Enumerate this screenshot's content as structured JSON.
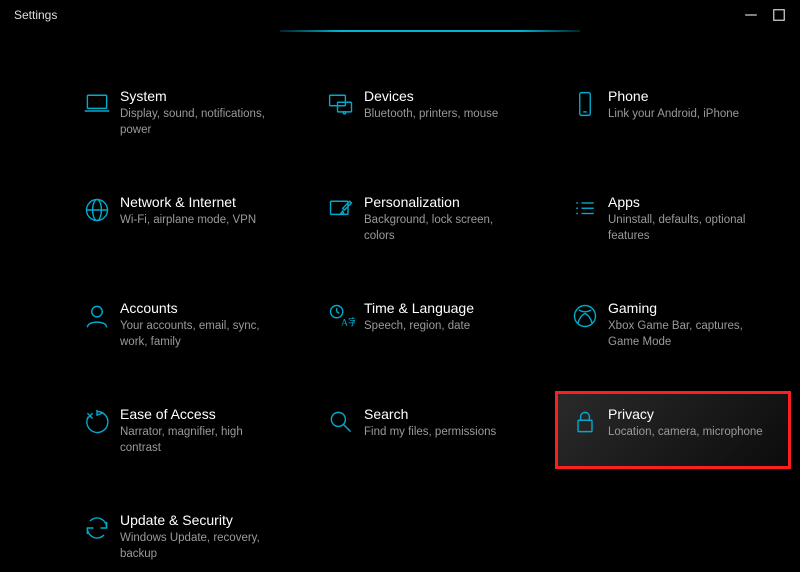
{
  "window": {
    "title": "Settings"
  },
  "accent_color": "#00aacc",
  "highlight_color": "#ff1e1e",
  "tiles": {
    "system": {
      "name": "System",
      "desc": "Display, sound, notifications, power"
    },
    "devices": {
      "name": "Devices",
      "desc": "Bluetooth, printers, mouse"
    },
    "phone": {
      "name": "Phone",
      "desc": "Link your Android, iPhone"
    },
    "network": {
      "name": "Network & Internet",
      "desc": "Wi-Fi, airplane mode, VPN"
    },
    "personalization": {
      "name": "Personalization",
      "desc": "Background, lock screen, colors"
    },
    "apps": {
      "name": "Apps",
      "desc": "Uninstall, defaults, optional features"
    },
    "accounts": {
      "name": "Accounts",
      "desc": "Your accounts, email, sync, work, family"
    },
    "time": {
      "name": "Time & Language",
      "desc": "Speech, region, date"
    },
    "gaming": {
      "name": "Gaming",
      "desc": "Xbox Game Bar, captures, Game Mode"
    },
    "ease": {
      "name": "Ease of Access",
      "desc": "Narrator, magnifier, high contrast"
    },
    "search": {
      "name": "Search",
      "desc": "Find my files, permissions"
    },
    "privacy": {
      "name": "Privacy",
      "desc": "Location, camera, microphone"
    },
    "update": {
      "name": "Update & Security",
      "desc": "Windows Update, recovery, backup"
    }
  }
}
